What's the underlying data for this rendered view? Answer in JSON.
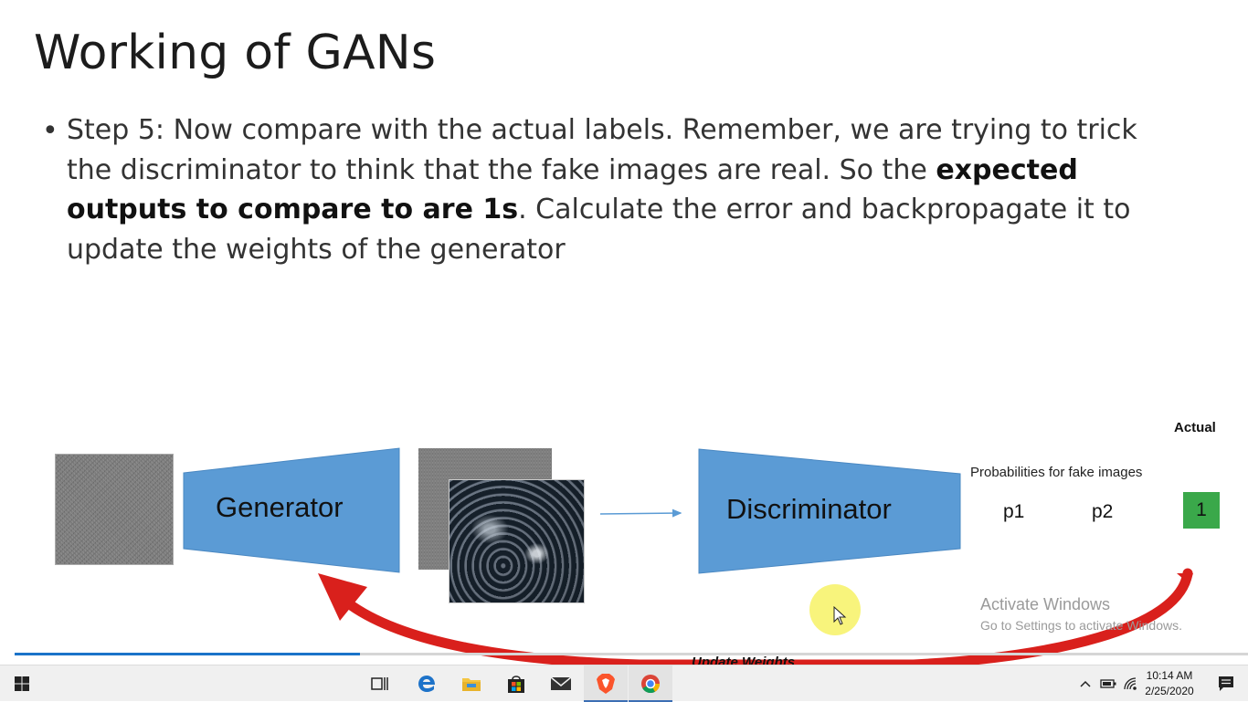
{
  "slide": {
    "title": "Working of GANs",
    "bullet_part1": "Step 5: Now compare with the actual labels. Remember, we are trying to trick the discriminator to think that the fake images are real. So the ",
    "bullet_bold": "expected outputs to compare to are 1s",
    "bullet_part2": ". Calculate the error and backpropagate it to update the weights of the generator",
    "diagram": {
      "generator_label": "Generator",
      "discriminator_label": "Discriminator",
      "actual_label": "Actual",
      "probabilities_label": "Probabilities for fake images",
      "p1": "p1",
      "p2": "p2",
      "actual_value": "1",
      "update_label": "Update Weights"
    }
  },
  "watermark": {
    "line1": "Activate Windows",
    "line2": "Go to Settings to activate Windows."
  },
  "video_progress": 0.28,
  "taskbar": {
    "apps": [
      "start-icon",
      "task-view-icon",
      "edge-icon",
      "file-explorer-icon",
      "store-icon",
      "mail-icon",
      "brave-icon",
      "chrome-icon"
    ],
    "time": "10:14 AM",
    "date": "2/25/2020"
  },
  "colors": {
    "shape_blue": "#5b9bd5",
    "actual_green": "#3aa84a",
    "arrow_red": "#d9201c"
  }
}
